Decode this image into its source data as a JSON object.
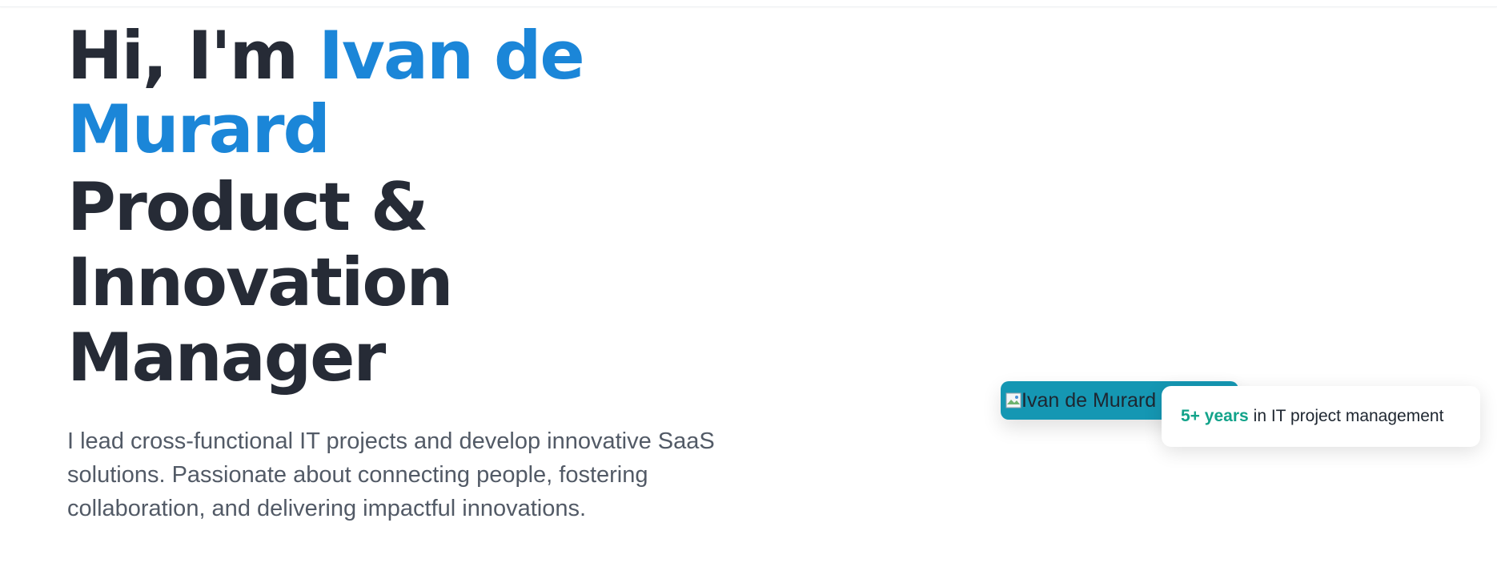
{
  "hero": {
    "greeting_prefix": "Hi, I'm ",
    "name": "Ivan de Murard",
    "role": "Product & Innovation Manager",
    "intro": "I lead cross-functional IT projects and develop innovative SaaS solutions. Passionate about connecting people, fostering collaboration, and delivering impactful innovations."
  },
  "portrait": {
    "alt": "Ivan de Murard",
    "icon": "broken-image-icon"
  },
  "stat_card": {
    "highlight": "5+ years",
    "text": "in IT project management"
  },
  "colors": {
    "heading": "#262b36",
    "accent": "#1b86d8",
    "body_text": "#525a66",
    "portrait_bg": "#1597b3",
    "stat_accent": "#12a38a"
  }
}
